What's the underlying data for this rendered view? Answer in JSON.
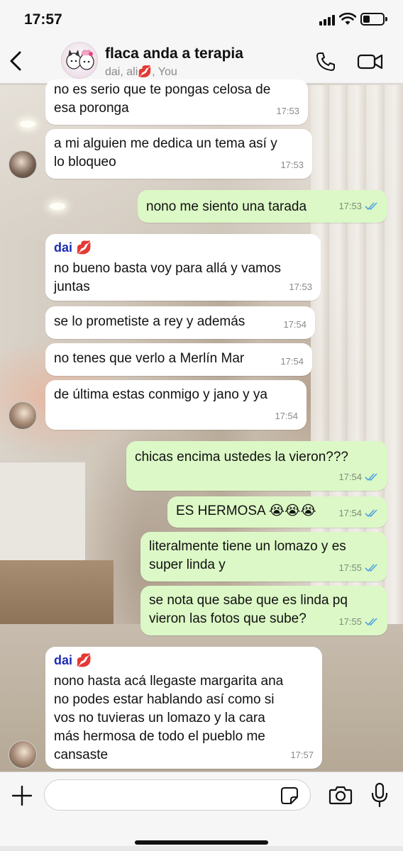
{
  "status_bar": {
    "time": "17:57"
  },
  "header": {
    "title": "flaca anda a terapia",
    "subtitle": "dai, ali💋, You"
  },
  "messages": [
    {
      "direction": "in",
      "text": "no es serio que te pongas celosa de\nesa poronga",
      "time": "17:53"
    },
    {
      "direction": "in",
      "text": "a mi alguien me dedica un tema así y\nlo bloqueo",
      "time": "17:53"
    },
    {
      "direction": "out",
      "text": "nono me siento una tarada",
      "time": "17:53"
    },
    {
      "direction": "in",
      "sender": "dai 💋",
      "text": "no bueno basta voy para allá y vamos\njuntas",
      "time": "17:53"
    },
    {
      "direction": "in",
      "text": "se lo prometiste a rey y además",
      "time": "17:54"
    },
    {
      "direction": "in",
      "text": "no tenes que verlo a Merlín Mar",
      "time": "17:54"
    },
    {
      "direction": "in",
      "text": "de última estas conmigo y jano y ya",
      "time": "17:54"
    },
    {
      "direction": "out",
      "text": "chicas encima ustedes la vieron???",
      "time": "17:54"
    },
    {
      "direction": "out",
      "text": "ES HERMOSA 😭😭😭",
      "time": "17:54"
    },
    {
      "direction": "out",
      "text": "literalmente tiene un lomazo y es\nsuper linda y",
      "time": "17:55"
    },
    {
      "direction": "out",
      "text": "se nota que sabe que es linda pq\nvieron las fotos que sube?",
      "time": "17:55"
    },
    {
      "direction": "in",
      "sender": "dai 💋",
      "text": "nono hasta acá llegaste margarita ana\nno podes estar hablando así como si\nvos no tuvieras un lomazo y la cara\nmás hermosa de todo el pueblo me\ncansaste",
      "time": "17:57"
    }
  ],
  "input": {
    "placeholder": ""
  },
  "colors": {
    "incoming_bubble": "#ffffff",
    "outgoing_bubble": "#dcf8c6",
    "sender_name": "#1c2bb5",
    "read_ticks": "#4fa3e0"
  },
  "icons": [
    "back-icon",
    "call-icon",
    "video-icon",
    "plus-icon",
    "sticker-icon",
    "camera-icon",
    "mic-icon",
    "double-check-icon"
  ]
}
